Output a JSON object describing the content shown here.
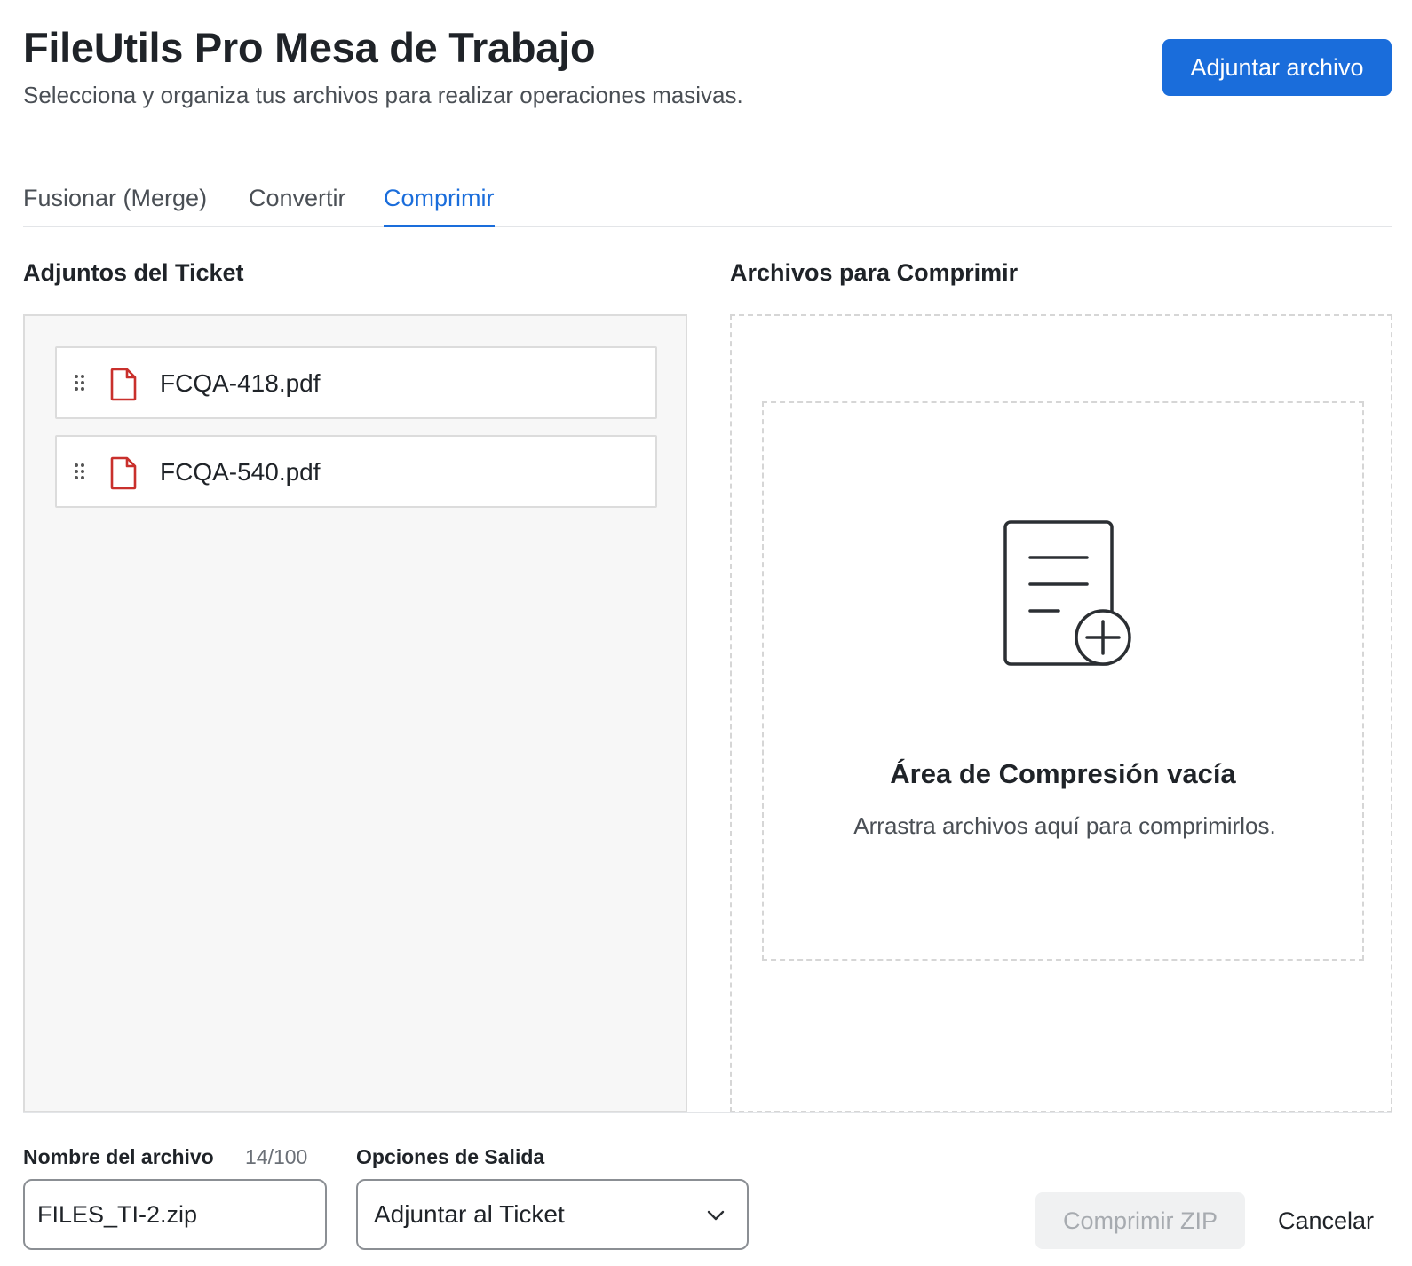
{
  "header": {
    "title": "FileUtils Pro Mesa de Trabajo",
    "subtitle": "Selecciona y organiza tus archivos para realizar operaciones masivas.",
    "attach_label": "Adjuntar archivo"
  },
  "tabs": [
    {
      "label": "Fusionar (Merge)",
      "active": false
    },
    {
      "label": "Convertir",
      "active": false
    },
    {
      "label": "Comprimir",
      "active": true
    }
  ],
  "left_panel": {
    "title": "Adjuntos del Ticket",
    "files": [
      {
        "name": "FCQA-418.pdf",
        "icon": "pdf-file-icon"
      },
      {
        "name": "FCQA-540.pdf",
        "icon": "pdf-file-icon"
      }
    ]
  },
  "right_panel": {
    "title": "Archivos para Comprimir",
    "empty_title": "Área de Compresión vacía",
    "empty_desc": "Arrastra archivos aquí para comprimirlos.",
    "empty_icon": "add-document-icon"
  },
  "form": {
    "name_label": "Nombre del archivo",
    "char_count": "14/100",
    "name_value": "FILES_TI-2.zip",
    "output_label": "Opciones de Salida",
    "output_value": "Adjuntar al Ticket"
  },
  "actions": {
    "compress_label": "Comprimir ZIP",
    "cancel_label": "Cancelar"
  },
  "colors": {
    "accent": "#1a6ddb",
    "pdf_icon": "#c9302c",
    "disabled_bg": "#f0f1f2",
    "disabled_text": "#a7abb0"
  }
}
